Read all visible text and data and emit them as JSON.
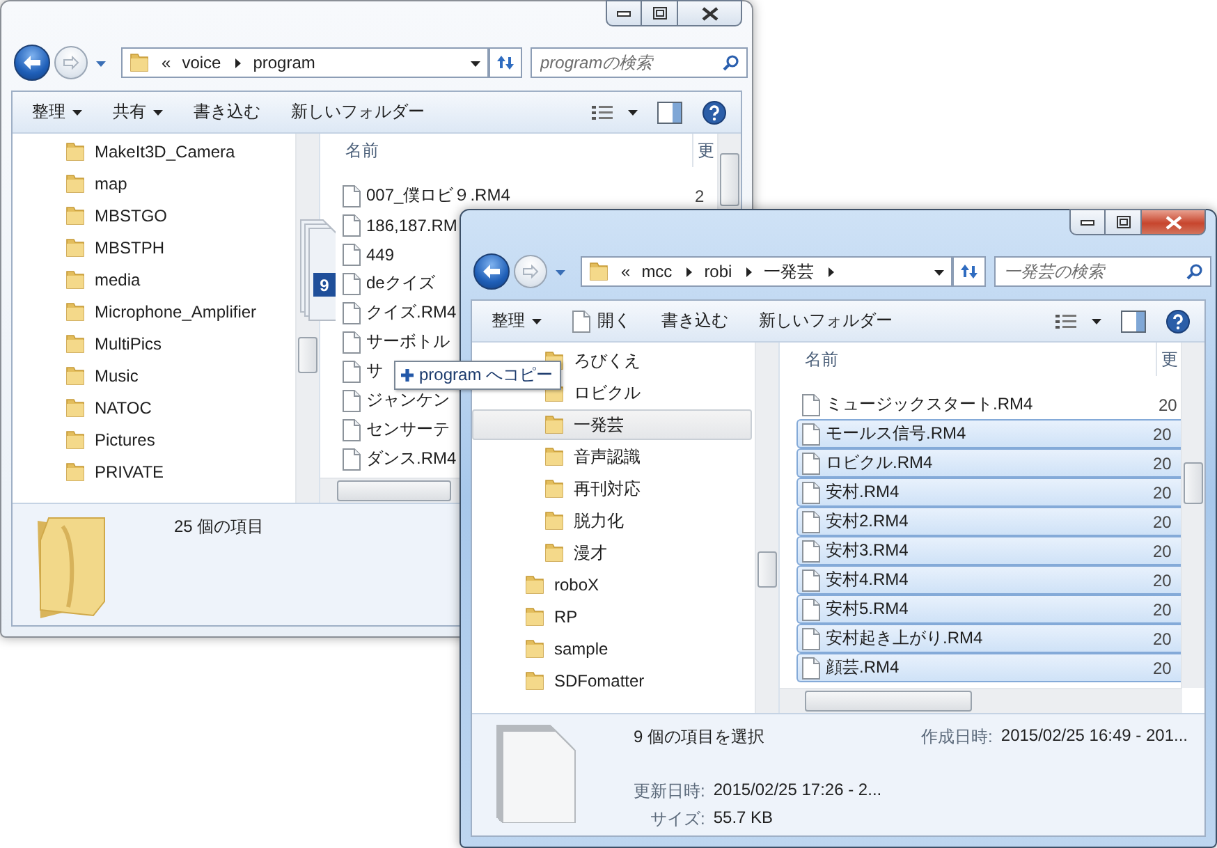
{
  "windows": [
    {
      "active": false,
      "address": {
        "prefix": "«",
        "segments": [
          "voice",
          "program"
        ],
        "trailing_separator": false
      },
      "search": {
        "placeholder": "programの検索"
      },
      "commands": [
        {
          "label": "整理",
          "kind": "menu"
        },
        {
          "label": "共有",
          "kind": "menu"
        },
        {
          "label": "書き込む",
          "kind": "plain"
        },
        {
          "label": "新しいフォルダー",
          "kind": "plain"
        }
      ],
      "tree": {
        "items": [
          {
            "label": "MakeIt3D_Camera",
            "selected": false
          },
          {
            "label": "map",
            "selected": false
          },
          {
            "label": "MBSTGO",
            "selected": false
          },
          {
            "label": "MBSTPH",
            "selected": false
          },
          {
            "label": "media",
            "selected": false
          },
          {
            "label": "Microphone_Amplifier",
            "selected": false
          },
          {
            "label": "MultiPics",
            "selected": false
          },
          {
            "label": "Music",
            "selected": false
          },
          {
            "label": "NATOC",
            "selected": false
          },
          {
            "label": "Pictures",
            "selected": false
          },
          {
            "label": "PRIVATE",
            "selected": false
          }
        ]
      },
      "files": {
        "columns": [
          "名前",
          "更"
        ],
        "rows": [
          {
            "name": "007_僕ロビ９.RM4",
            "date": "2",
            "selected": false
          },
          {
            "name": "186,187.RM",
            "selected": false
          },
          {
            "name": "449",
            "selected": false
          },
          {
            "name": "deクイズ",
            "selected": false
          },
          {
            "name": "クイズ.RM4",
            "selected": false
          },
          {
            "name": "サーボトル",
            "selected": false
          },
          {
            "name": "サ",
            "selected": false
          },
          {
            "name": "ジャンケン",
            "selected": false
          },
          {
            "name": "センサーテ",
            "selected": false
          },
          {
            "name": "ダンス.RM4",
            "selected": false
          }
        ]
      },
      "details": {
        "kind": "folder",
        "summary": "25 個の項目"
      }
    },
    {
      "active": true,
      "address": {
        "prefix": "«",
        "segments": [
          "mcc",
          "robi",
          "一発芸"
        ],
        "trailing_separator": true
      },
      "search": {
        "placeholder": "一発芸の検索"
      },
      "commands": [
        {
          "label": "整理",
          "kind": "menu"
        },
        {
          "label": "開く",
          "kind": "file"
        },
        {
          "label": "書き込む",
          "kind": "plain"
        },
        {
          "label": "新しいフォルダー",
          "kind": "plain"
        }
      ],
      "tree": {
        "items": [
          {
            "children": [
              {
                "label": "ろびくえ",
                "selected": false
              },
              {
                "label": "ロビクル",
                "selected": false
              },
              {
                "label": "一発芸",
                "selected": true
              },
              {
                "label": "音声認識",
                "selected": false
              },
              {
                "label": "再刊対応",
                "selected": false
              },
              {
                "label": "脱力化",
                "selected": false
              },
              {
                "label": "漫才",
                "selected": false
              }
            ]
          },
          {
            "label": "roboX",
            "selected": false
          },
          {
            "label": "RP",
            "selected": false
          },
          {
            "label": "sample",
            "selected": false
          },
          {
            "label": "SDFomatter",
            "selected": false
          }
        ]
      },
      "files": {
        "columns": [
          "名前",
          "更"
        ],
        "rows": [
          {
            "name": "ミュージックスタート.RM4",
            "date": "20",
            "selected": false
          },
          {
            "name": "モールス信号.RM4",
            "date": "20",
            "selected": true
          },
          {
            "name": "ロビクル.RM4",
            "date": "20",
            "selected": true
          },
          {
            "name": "安村.RM4",
            "date": "20",
            "selected": true
          },
          {
            "name": "安村2.RM4",
            "date": "20",
            "selected": true
          },
          {
            "name": "安村3.RM4",
            "date": "20",
            "selected": true
          },
          {
            "name": "安村4.RM4",
            "date": "20",
            "selected": true
          },
          {
            "name": "安村5.RM4",
            "date": "20",
            "selected": true
          },
          {
            "name": "安村起き上がり.RM4",
            "date": "20",
            "selected": true
          },
          {
            "name": "顔芸.RM4",
            "date": "20",
            "selected": true
          }
        ]
      },
      "details": {
        "kind": "files",
        "summary": "9 個の項目を選択",
        "properties": [
          {
            "label": "作成日時:",
            "value": "2015/02/25 16:49 - 201..."
          },
          {
            "label": "更新日時:",
            "value": "2015/02/25 17:26 - 2..."
          },
          {
            "label": "サイズ:",
            "value": "55.7 KB"
          }
        ]
      }
    }
  ],
  "drag": {
    "count": "9",
    "tooltip": "program へコピー"
  }
}
